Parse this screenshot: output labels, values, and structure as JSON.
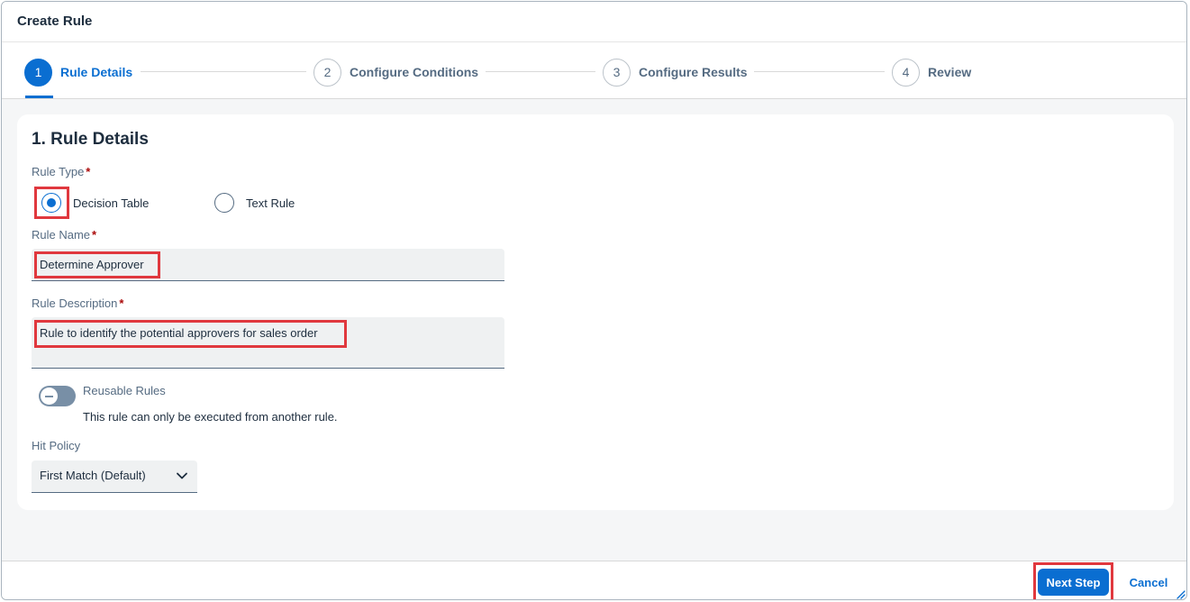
{
  "dialog": {
    "title": "Create Rule"
  },
  "wizard": {
    "steps": [
      {
        "number": "1",
        "label": "Rule Details"
      },
      {
        "number": "2",
        "label": "Configure Conditions"
      },
      {
        "number": "3",
        "label": "Configure Results"
      },
      {
        "number": "4",
        "label": "Review"
      }
    ],
    "active_step": 1
  },
  "section": {
    "title": "1. Rule Details"
  },
  "rule_type": {
    "label": "Rule Type",
    "required_marker": "*",
    "options": [
      "Decision Table",
      "Text Rule"
    ],
    "selected": "Decision Table"
  },
  "rule_name": {
    "label": "Rule Name",
    "required_marker": "*",
    "value": "Determine Approver"
  },
  "rule_description": {
    "label": "Rule Description",
    "required_marker": "*",
    "value": "Rule to identify the potential approvers for sales order"
  },
  "reusable": {
    "title": "Reusable Rules",
    "description": "This rule can only be executed from another rule.",
    "enabled": false
  },
  "hit_policy": {
    "label": "Hit Policy",
    "value": "First Match (Default)"
  },
  "footer": {
    "next_label": "Next Step",
    "cancel_label": "Cancel"
  },
  "colors": {
    "accent": "#0a6ed1",
    "highlight": "#e0383e",
    "required": "#aa0808"
  },
  "icons": {
    "dropdown": "chevron-down-icon",
    "resize": "resize-handle-icon"
  }
}
